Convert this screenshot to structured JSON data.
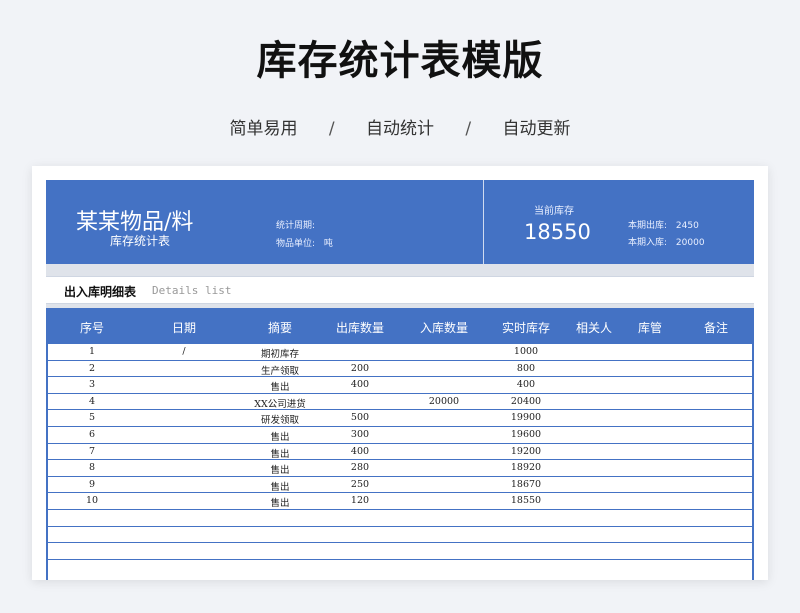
{
  "title": "库存统计表模版",
  "subtitle": {
    "items": [
      "简单易用",
      "自动统计",
      "自动更新"
    ],
    "separator": "/"
  },
  "sheet": {
    "item_name": "某某物品/料",
    "item_sub": "库存统计表",
    "stat_period_label": "统计周期:",
    "unit_label": "物品单位:",
    "unit_value": "吨",
    "current_stock_label": "当前库存",
    "current_stock_value": "18550",
    "period_out_label": "本期出库:",
    "period_out_value": "2450",
    "period_in_label": "本期入库:",
    "period_in_value": "20000",
    "section_title": "出入库明细表",
    "section_en": "Details list",
    "colors": {
      "accent": "#4472c4",
      "strip": "#dfe3ea"
    }
  },
  "table": {
    "headers": [
      "序号",
      "日期",
      "摘要",
      "出库数量",
      "入库数量",
      "实时库存",
      "相关人",
      "库管",
      "备注"
    ],
    "rows": [
      [
        "1",
        "/",
        "期初库存",
        "",
        "",
        "1000",
        "",
        "",
        ""
      ],
      [
        "2",
        "",
        "生产领取",
        "200",
        "",
        "800",
        "",
        "",
        ""
      ],
      [
        "3",
        "",
        "售出",
        "400",
        "",
        "400",
        "",
        "",
        ""
      ],
      [
        "4",
        "",
        "XX公司进货",
        "",
        "20000",
        "20400",
        "",
        "",
        ""
      ],
      [
        "5",
        "",
        "研发领取",
        "500",
        "",
        "19900",
        "",
        "",
        ""
      ],
      [
        "6",
        "",
        "售出",
        "300",
        "",
        "19600",
        "",
        "",
        ""
      ],
      [
        "7",
        "",
        "售出",
        "400",
        "",
        "19200",
        "",
        "",
        ""
      ],
      [
        "8",
        "",
        "售出",
        "280",
        "",
        "18920",
        "",
        "",
        ""
      ],
      [
        "9",
        "",
        "售出",
        "250",
        "",
        "18670",
        "",
        "",
        ""
      ],
      [
        "10",
        "",
        "售出",
        "120",
        "",
        "18550",
        "",
        "",
        ""
      ],
      [
        "",
        "",
        "",
        "",
        "",
        "",
        "",
        "",
        ""
      ],
      [
        "",
        "",
        "",
        "",
        "",
        "",
        "",
        "",
        ""
      ],
      [
        "",
        "",
        "",
        "",
        "",
        "",
        "",
        "",
        ""
      ]
    ]
  }
}
